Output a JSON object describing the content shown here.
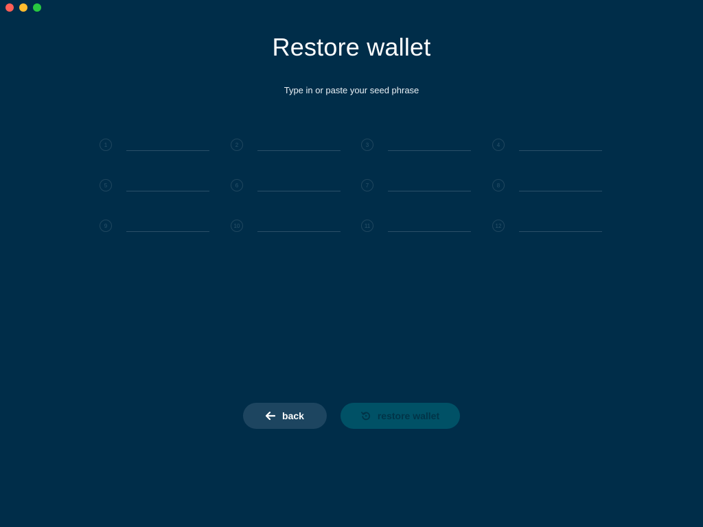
{
  "window": {
    "controls": [
      "close",
      "minimize",
      "zoom"
    ]
  },
  "header": {
    "title": "Restore wallet",
    "subtitle": "Type in or paste your seed phrase"
  },
  "seed_words": [
    {
      "number": "1",
      "value": ""
    },
    {
      "number": "2",
      "value": ""
    },
    {
      "number": "3",
      "value": ""
    },
    {
      "number": "4",
      "value": ""
    },
    {
      "number": "5",
      "value": ""
    },
    {
      "number": "6",
      "value": ""
    },
    {
      "number": "7",
      "value": ""
    },
    {
      "number": "8",
      "value": ""
    },
    {
      "number": "9",
      "value": ""
    },
    {
      "number": "10",
      "value": ""
    },
    {
      "number": "11",
      "value": ""
    },
    {
      "number": "12",
      "value": ""
    }
  ],
  "actions": {
    "back_label": "back",
    "back_icon": "arrow-left-icon",
    "restore_label": "restore wallet",
    "restore_icon": "restore-icon",
    "restore_enabled": false
  },
  "colors": {
    "background": "#002d49",
    "back_button": "#1d4560",
    "restore_button": "#005166"
  }
}
